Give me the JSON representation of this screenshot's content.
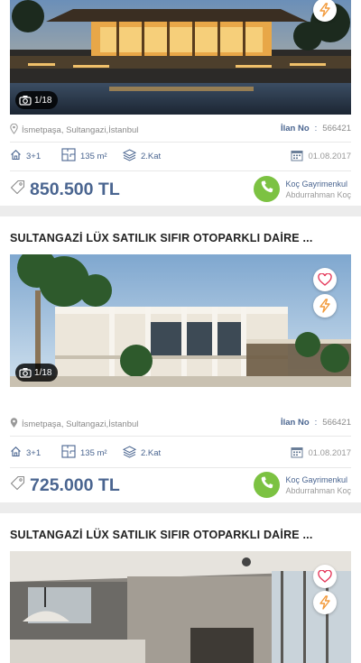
{
  "colors": {
    "accent": "#4a6590",
    "call_green": "#7cc242",
    "favorite_red": "#e5395b",
    "bolt_orange": "#f29a3b"
  },
  "listings": [
    {
      "title": "",
      "photo_count": "1/18",
      "location": "İsmetpaşa, Sultangazi,İstanbul",
      "ilan_label": "İlan No",
      "ilan_colon": ":",
      "ilan_no": "566421",
      "rooms": "3+1",
      "area": "135 m²",
      "floor": "2.Kat",
      "date": "01.08.2017",
      "price": "850.500 TL",
      "agency": "Koç Gayrimenkul",
      "agent": "Abdurrahman Koç"
    },
    {
      "title": "SULTANGAZİ LÜX  SATILIK SIFIR  OTOPARKLI DAİRE ...",
      "photo_count": "1/18",
      "location": "İsmetpaşa, Sultangazi,İstanbul",
      "ilan_label": "İlan No",
      "ilan_colon": ":",
      "ilan_no": "566421",
      "rooms": "3+1",
      "area": "135 m²",
      "floor": "2.Kat",
      "date": "01.08.2017",
      "price": "725.000 TL",
      "agency": "Koç Gayrimenkul",
      "agent": "Abdurrahman Koç"
    },
    {
      "title": "SULTANGAZİ LÜX  SATILIK SIFIR  OTOPARKLI DAİRE ..."
    }
  ]
}
